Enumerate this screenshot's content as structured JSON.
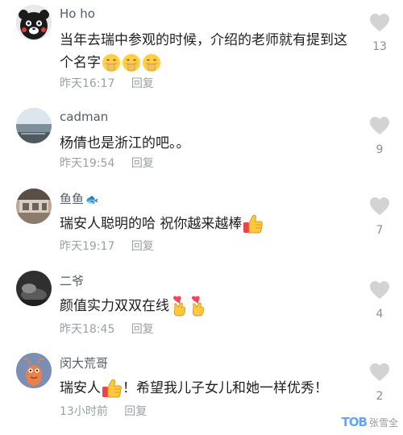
{
  "comments": [
    {
      "username": "Ho ho",
      "text": "当年去瑞中参观的时候，介绍的老师就有提到这个名字",
      "time": "昨天16:17",
      "reply_label": "回复",
      "likes": "13",
      "avatar_icon": "kumamon-avatar",
      "trailing_emojis": [
        "hand-over-mouth-emoji",
        "hand-over-mouth-emoji",
        "hand-over-mouth-emoji"
      ]
    },
    {
      "username": "cadman",
      "text": "杨倩也是浙江的吧。。",
      "time": "昨天19:54",
      "reply_label": "回复",
      "likes": "9",
      "avatar_icon": "sea-landscape-avatar"
    },
    {
      "username": "鱼鱼",
      "username_badge": "🐟",
      "text": "瑞安人聪明的哈 祝你越来越棒",
      "time": "昨天19:17",
      "reply_label": "回复",
      "likes": "7",
      "avatar_icon": "street-photo-avatar",
      "trailing_emojis": [
        "thumbs-up-emoji"
      ]
    },
    {
      "username": "二爷",
      "text": "颜值实力双双在线",
      "time": "昨天18:45",
      "reply_label": "回复",
      "likes": "4",
      "avatar_icon": "dark-scene-avatar",
      "trailing_emojis": [
        "finger-heart-emoji",
        "finger-heart-emoji"
      ]
    },
    {
      "username": "闵大荒哥",
      "text_before": "瑞安人",
      "text_after": "！希望我儿子女儿和她一样优秀！",
      "time": "13小时前",
      "reply_label": "回复",
      "likes": "2",
      "avatar_icon": "cartoon-shrimp-avatar",
      "inline_emoji": "thumbs-up-emoji"
    }
  ],
  "watermark": {
    "logo": "TOB",
    "text": "张雪全"
  },
  "colors": {
    "username": "#555b66",
    "meta": "#9aa0a6",
    "heart": "#d3d3d3",
    "text": "#1f1f1f"
  }
}
